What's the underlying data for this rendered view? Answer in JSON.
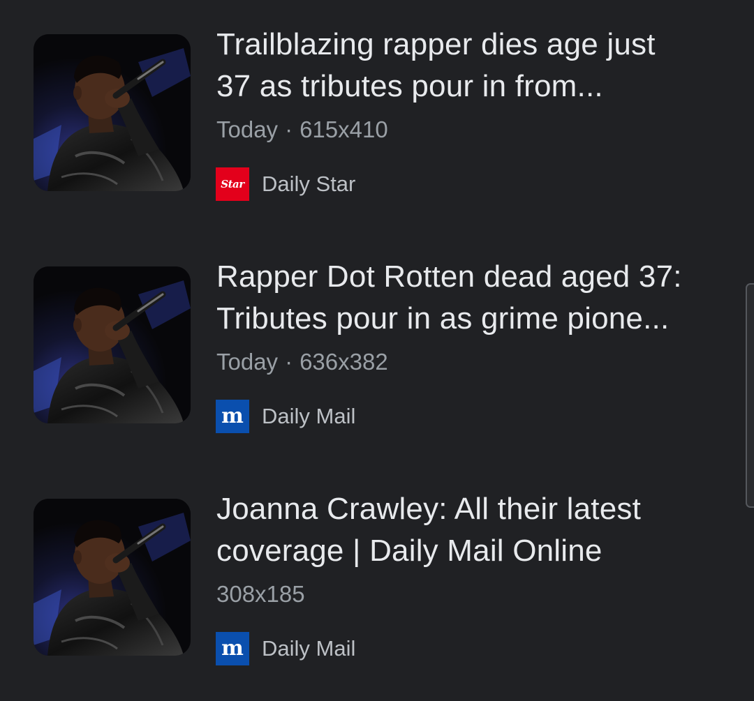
{
  "results": [
    {
      "title_lines": [
        "Trailblazing rapper dies age just",
        "37 as tributes pour in from..."
      ],
      "date": "Today",
      "separator": "·",
      "dimensions": "615x410",
      "source": "Daily Star",
      "source_logo_text": "Star",
      "source_logo_color": "#e3001b"
    },
    {
      "title_lines": [
        "Rapper Dot Rotten dead aged 37:",
        "Tributes pour in as grime pione..."
      ],
      "date": "Today",
      "separator": "·",
      "dimensions": "636x382",
      "source": "Daily Mail",
      "source_logo_text": "m",
      "source_logo_color": "#0a4fae"
    },
    {
      "title_lines": [
        "Joanna Crawley: All their latest",
        "coverage | Daily Mail Online"
      ],
      "dimensions": "308x185",
      "source": "Daily Mail",
      "source_logo_text": "m",
      "source_logo_color": "#0a4fae"
    }
  ],
  "colors": {
    "background": "#202124",
    "title": "#e8eaed",
    "meta": "#9aa0a6",
    "source": "#bdc1c6"
  }
}
